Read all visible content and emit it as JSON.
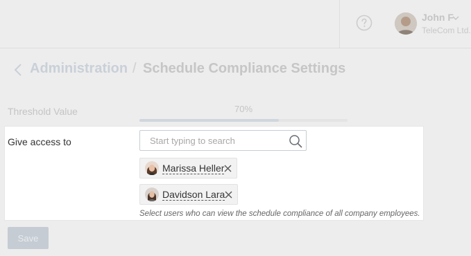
{
  "header": {
    "help_icon": "question-circle-icon",
    "user": {
      "name": "John F",
      "company": "TeleCom Ltd.",
      "menu_icon": "chevron-down-icon"
    }
  },
  "breadcrumb": {
    "back_icon": "chevron-left-icon",
    "parent": "Administration",
    "separator": "/",
    "current": "Schedule Compliance Settings"
  },
  "threshold": {
    "label": "Threshold Value",
    "value_text": "70%",
    "level_fraction": 0.67
  },
  "access": {
    "label": "Give access to",
    "search_placeholder": "Start typing to search",
    "search_icon": "search-icon",
    "selected_users": [
      {
        "name": "Marissa Heller",
        "remove_icon": "close-icon"
      },
      {
        "name": "Davidson Lara",
        "remove_icon": "close-icon"
      }
    ],
    "hint": "Select users who can view the schedule compliance of all company employees."
  },
  "actions": {
    "save_label": "Save"
  },
  "colors": {
    "background": "#ededed",
    "panel": "#ffffff",
    "accent_disabled": "#c5ccd3",
    "text": "#333333"
  }
}
